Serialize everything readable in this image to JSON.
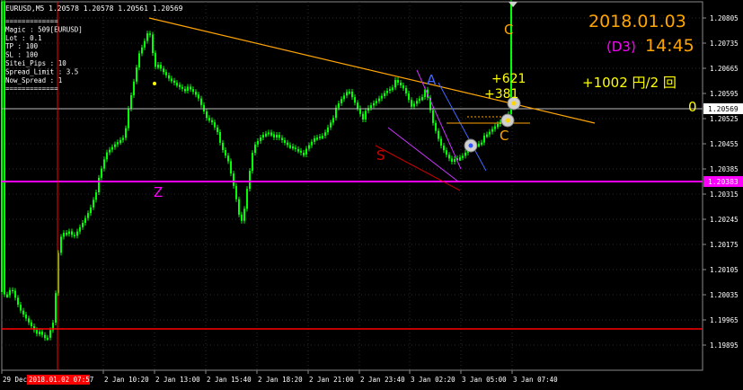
{
  "symbol_header": "EURUSD,M5  1.20578 1.20578 1.20561 1.20569",
  "ea_panel": {
    "lines": [
      "=============",
      "Magic : 509[EURUSD]",
      "Lot : 0.1",
      "TP : 100",
      "SL : 100",
      "Sitei_Pips : 10",
      "Spread_Limit : 3.5",
      "Now_Spread : 1",
      "============="
    ]
  },
  "overlay": {
    "date": "2018.01.03",
    "day": "(D3)",
    "time": "14:45",
    "profit_summary": "+1002 円/2 回",
    "zero": "0",
    "trade1": "+621",
    "trade2": "+381"
  },
  "wave_labels": {
    "c_top": "C",
    "a": "A",
    "s": "S",
    "z": "Z",
    "c_small": "C"
  },
  "price_axis": {
    "ticks": [
      "1.20805",
      "1.20735",
      "1.20665",
      "1.20595",
      "1.20525",
      "1.20455",
      "1.20385",
      "1.20315",
      "1.20245",
      "1.20175",
      "1.20105",
      "1.20035",
      "1.19965",
      "1.19895"
    ],
    "current_price": "1.20569",
    "marked_price": "1.20383"
  },
  "time_axis": {
    "ticks": [
      "29 Dec 2017",
      "2 Jan 10:20",
      "2 Jan 13:00",
      "2 Jan 15:40",
      "2 Jan 18:20",
      "2 Jan 21:00",
      "2 Jan 23:40",
      "3 Jan 02:20",
      "3 Jan 05:00",
      "3 Jan 07:40"
    ],
    "highlighted": "2018.01.02 07:57"
  },
  "colors": {
    "candle_up": "#00ff00",
    "candle_down": "#00ff00",
    "grid": "#2a2a2a",
    "magenta_line": "#ff00ff",
    "red_line": "#ff0000",
    "orange_trend": "#ffa500",
    "overlay_gold": "#ffa500",
    "overlay_magenta": "#ff00ff",
    "overlay_yellow": "#ffff00"
  }
}
